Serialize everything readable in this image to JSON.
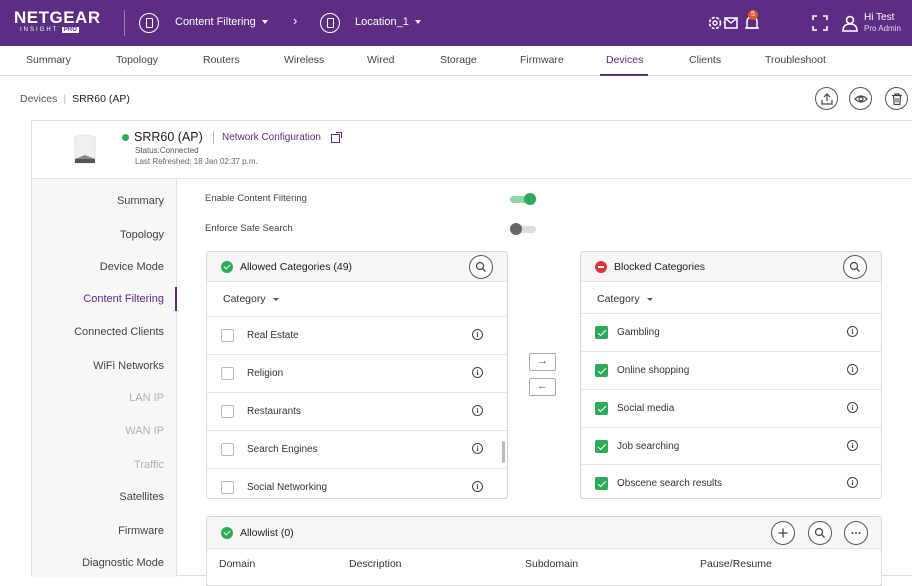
{
  "topbar": {
    "logo_text": "NETGEAR",
    "logo_sub": "INSIGHT",
    "logo_badge": "PRO",
    "breadcrumb_1": "Content Filtering",
    "separator": "›",
    "breadcrumb_2": "Location_1",
    "notification_count": "5",
    "user_name": "Hi Test",
    "user_role": "Pro Admin"
  },
  "nav": {
    "tabs": [
      "Summary",
      "Topology",
      "Routers",
      "Wireless",
      "Wired",
      "Storage",
      "Firmware",
      "Devices",
      "Clients",
      "Troubleshoot"
    ],
    "active": "Devices"
  },
  "breadcrumb": {
    "root": "Devices",
    "separator": "|",
    "current": "SRR60 (AP)"
  },
  "device": {
    "name": "SRR60 (AP)",
    "config_link": "Network Configuration",
    "status": "Status:Connected",
    "refreshed": "Last Refreshed: 18 Jan 02:37 p.m."
  },
  "sidebar": {
    "items": [
      "Summary",
      "Topology",
      "Device Mode",
      "Content Filtering",
      "Connected Clients",
      "WiFi Networks",
      "LAN IP",
      "WAN IP",
      "Traffic",
      "Satellites",
      "Firmware",
      "Diagnostic Mode"
    ],
    "active": "Content Filtering"
  },
  "settings": {
    "enable_label": "Enable Content Filtering",
    "enable_on": true,
    "safe_search_label": "Enforce Safe Search",
    "safe_search_on": false
  },
  "allowed": {
    "title": "Allowed Categories (49)",
    "dropdown": "Category",
    "items": [
      "Real Estate",
      "Religion",
      "Restaurants",
      "Search Engines",
      "Social Networking"
    ]
  },
  "blocked": {
    "title": "Blocked Categories",
    "dropdown": "Category",
    "items": [
      "Gambling",
      "Online shopping",
      "Social media",
      "Job searching",
      "Obscene search results"
    ]
  },
  "transfer": {
    "right": "→",
    "left": "←"
  },
  "allowlist": {
    "title": "Allowlist (0)",
    "columns": [
      "Domain",
      "Description",
      "Subdomain",
      "Pause/Resume"
    ]
  },
  "colors": {
    "brand": "#5c2d82",
    "success": "#2fa95a",
    "danger": "#e0343a"
  },
  "icons": [
    "settings-icon",
    "message-icon",
    "bell-icon",
    "fullscreen-icon",
    "user-icon",
    "upload-icon",
    "eye-icon",
    "trash-icon",
    "search-icon",
    "plus-icon",
    "more-icon",
    "info-icon",
    "external-link-icon"
  ]
}
